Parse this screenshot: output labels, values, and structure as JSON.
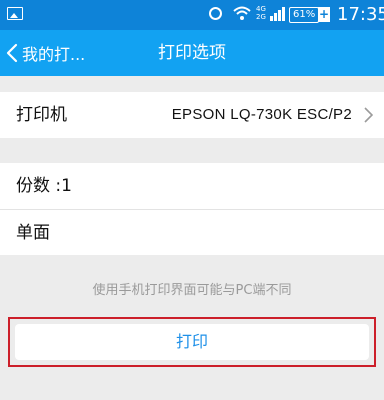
{
  "status_bar": {
    "time": "17:35",
    "battery": "61%",
    "network_top": "4G",
    "network_bottom": "2G",
    "icons": [
      "image-icon",
      "alarm-icon",
      "wifi-icon",
      "signal-icon",
      "battery-icon",
      "charging-icon"
    ]
  },
  "header": {
    "back_label": "我的打...",
    "title": "打印选项"
  },
  "printer": {
    "label": "打印机",
    "value": "EPSON LQ-730K ESC/P2"
  },
  "options": {
    "copies_label": "份数 :1",
    "sides_label": "单面"
  },
  "note": "使用手机打印界面可能与PC端不同",
  "print_button": "打印",
  "colors": {
    "status_bar": "#0e83d8",
    "title_bar": "#12a2f2",
    "button_text": "#1e90e8",
    "highlight_border": "#cc1f2a"
  }
}
